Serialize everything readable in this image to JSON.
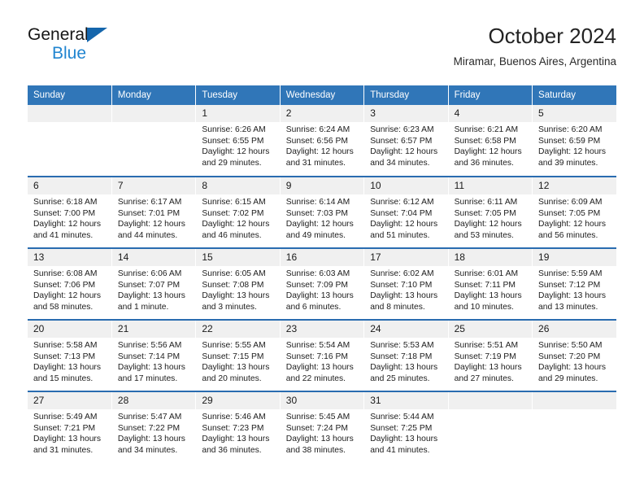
{
  "brand": {
    "line1": "General",
    "line2": "Blue",
    "triangle_color": "#1566ac",
    "blue_text_color": "#2185d0"
  },
  "header": {
    "title": "October 2024",
    "subtitle": "Miramar, Buenos Aires, Argentina"
  },
  "theme": {
    "header_blue": "#3076b8",
    "row_divider_blue": "#2a6cb0",
    "daynum_band": "#f0f0f0"
  },
  "weekday_headers": [
    "Sunday",
    "Monday",
    "Tuesday",
    "Wednesday",
    "Thursday",
    "Friday",
    "Saturday"
  ],
  "weeks": [
    [
      {
        "day": "",
        "sunrise": "",
        "sunset": "",
        "daylight_line1": "",
        "daylight_line2": ""
      },
      {
        "day": "",
        "sunrise": "",
        "sunset": "",
        "daylight_line1": "",
        "daylight_line2": ""
      },
      {
        "day": "1",
        "sunrise": "Sunrise: 6:26 AM",
        "sunset": "Sunset: 6:55 PM",
        "daylight_line1": "Daylight: 12 hours",
        "daylight_line2": "and 29 minutes."
      },
      {
        "day": "2",
        "sunrise": "Sunrise: 6:24 AM",
        "sunset": "Sunset: 6:56 PM",
        "daylight_line1": "Daylight: 12 hours",
        "daylight_line2": "and 31 minutes."
      },
      {
        "day": "3",
        "sunrise": "Sunrise: 6:23 AM",
        "sunset": "Sunset: 6:57 PM",
        "daylight_line1": "Daylight: 12 hours",
        "daylight_line2": "and 34 minutes."
      },
      {
        "day": "4",
        "sunrise": "Sunrise: 6:21 AM",
        "sunset": "Sunset: 6:58 PM",
        "daylight_line1": "Daylight: 12 hours",
        "daylight_line2": "and 36 minutes."
      },
      {
        "day": "5",
        "sunrise": "Sunrise: 6:20 AM",
        "sunset": "Sunset: 6:59 PM",
        "daylight_line1": "Daylight: 12 hours",
        "daylight_line2": "and 39 minutes."
      }
    ],
    [
      {
        "day": "6",
        "sunrise": "Sunrise: 6:18 AM",
        "sunset": "Sunset: 7:00 PM",
        "daylight_line1": "Daylight: 12 hours",
        "daylight_line2": "and 41 minutes."
      },
      {
        "day": "7",
        "sunrise": "Sunrise: 6:17 AM",
        "sunset": "Sunset: 7:01 PM",
        "daylight_line1": "Daylight: 12 hours",
        "daylight_line2": "and 44 minutes."
      },
      {
        "day": "8",
        "sunrise": "Sunrise: 6:15 AM",
        "sunset": "Sunset: 7:02 PM",
        "daylight_line1": "Daylight: 12 hours",
        "daylight_line2": "and 46 minutes."
      },
      {
        "day": "9",
        "sunrise": "Sunrise: 6:14 AM",
        "sunset": "Sunset: 7:03 PM",
        "daylight_line1": "Daylight: 12 hours",
        "daylight_line2": "and 49 minutes."
      },
      {
        "day": "10",
        "sunrise": "Sunrise: 6:12 AM",
        "sunset": "Sunset: 7:04 PM",
        "daylight_line1": "Daylight: 12 hours",
        "daylight_line2": "and 51 minutes."
      },
      {
        "day": "11",
        "sunrise": "Sunrise: 6:11 AM",
        "sunset": "Sunset: 7:05 PM",
        "daylight_line1": "Daylight: 12 hours",
        "daylight_line2": "and 53 minutes."
      },
      {
        "day": "12",
        "sunrise": "Sunrise: 6:09 AM",
        "sunset": "Sunset: 7:05 PM",
        "daylight_line1": "Daylight: 12 hours",
        "daylight_line2": "and 56 minutes."
      }
    ],
    [
      {
        "day": "13",
        "sunrise": "Sunrise: 6:08 AM",
        "sunset": "Sunset: 7:06 PM",
        "daylight_line1": "Daylight: 12 hours",
        "daylight_line2": "and 58 minutes."
      },
      {
        "day": "14",
        "sunrise": "Sunrise: 6:06 AM",
        "sunset": "Sunset: 7:07 PM",
        "daylight_line1": "Daylight: 13 hours",
        "daylight_line2": "and 1 minute."
      },
      {
        "day": "15",
        "sunrise": "Sunrise: 6:05 AM",
        "sunset": "Sunset: 7:08 PM",
        "daylight_line1": "Daylight: 13 hours",
        "daylight_line2": "and 3 minutes."
      },
      {
        "day": "16",
        "sunrise": "Sunrise: 6:03 AM",
        "sunset": "Sunset: 7:09 PM",
        "daylight_line1": "Daylight: 13 hours",
        "daylight_line2": "and 6 minutes."
      },
      {
        "day": "17",
        "sunrise": "Sunrise: 6:02 AM",
        "sunset": "Sunset: 7:10 PM",
        "daylight_line1": "Daylight: 13 hours",
        "daylight_line2": "and 8 minutes."
      },
      {
        "day": "18",
        "sunrise": "Sunrise: 6:01 AM",
        "sunset": "Sunset: 7:11 PM",
        "daylight_line1": "Daylight: 13 hours",
        "daylight_line2": "and 10 minutes."
      },
      {
        "day": "19",
        "sunrise": "Sunrise: 5:59 AM",
        "sunset": "Sunset: 7:12 PM",
        "daylight_line1": "Daylight: 13 hours",
        "daylight_line2": "and 13 minutes."
      }
    ],
    [
      {
        "day": "20",
        "sunrise": "Sunrise: 5:58 AM",
        "sunset": "Sunset: 7:13 PM",
        "daylight_line1": "Daylight: 13 hours",
        "daylight_line2": "and 15 minutes."
      },
      {
        "day": "21",
        "sunrise": "Sunrise: 5:56 AM",
        "sunset": "Sunset: 7:14 PM",
        "daylight_line1": "Daylight: 13 hours",
        "daylight_line2": "and 17 minutes."
      },
      {
        "day": "22",
        "sunrise": "Sunrise: 5:55 AM",
        "sunset": "Sunset: 7:15 PM",
        "daylight_line1": "Daylight: 13 hours",
        "daylight_line2": "and 20 minutes."
      },
      {
        "day": "23",
        "sunrise": "Sunrise: 5:54 AM",
        "sunset": "Sunset: 7:16 PM",
        "daylight_line1": "Daylight: 13 hours",
        "daylight_line2": "and 22 minutes."
      },
      {
        "day": "24",
        "sunrise": "Sunrise: 5:53 AM",
        "sunset": "Sunset: 7:18 PM",
        "daylight_line1": "Daylight: 13 hours",
        "daylight_line2": "and 25 minutes."
      },
      {
        "day": "25",
        "sunrise": "Sunrise: 5:51 AM",
        "sunset": "Sunset: 7:19 PM",
        "daylight_line1": "Daylight: 13 hours",
        "daylight_line2": "and 27 minutes."
      },
      {
        "day": "26",
        "sunrise": "Sunrise: 5:50 AM",
        "sunset": "Sunset: 7:20 PM",
        "daylight_line1": "Daylight: 13 hours",
        "daylight_line2": "and 29 minutes."
      }
    ],
    [
      {
        "day": "27",
        "sunrise": "Sunrise: 5:49 AM",
        "sunset": "Sunset: 7:21 PM",
        "daylight_line1": "Daylight: 13 hours",
        "daylight_line2": "and 31 minutes."
      },
      {
        "day": "28",
        "sunrise": "Sunrise: 5:47 AM",
        "sunset": "Sunset: 7:22 PM",
        "daylight_line1": "Daylight: 13 hours",
        "daylight_line2": "and 34 minutes."
      },
      {
        "day": "29",
        "sunrise": "Sunrise: 5:46 AM",
        "sunset": "Sunset: 7:23 PM",
        "daylight_line1": "Daylight: 13 hours",
        "daylight_line2": "and 36 minutes."
      },
      {
        "day": "30",
        "sunrise": "Sunrise: 5:45 AM",
        "sunset": "Sunset: 7:24 PM",
        "daylight_line1": "Daylight: 13 hours",
        "daylight_line2": "and 38 minutes."
      },
      {
        "day": "31",
        "sunrise": "Sunrise: 5:44 AM",
        "sunset": "Sunset: 7:25 PM",
        "daylight_line1": "Daylight: 13 hours",
        "daylight_line2": "and 41 minutes."
      },
      {
        "day": "",
        "sunrise": "",
        "sunset": "",
        "daylight_line1": "",
        "daylight_line2": ""
      },
      {
        "day": "",
        "sunrise": "",
        "sunset": "",
        "daylight_line1": "",
        "daylight_line2": ""
      }
    ]
  ]
}
